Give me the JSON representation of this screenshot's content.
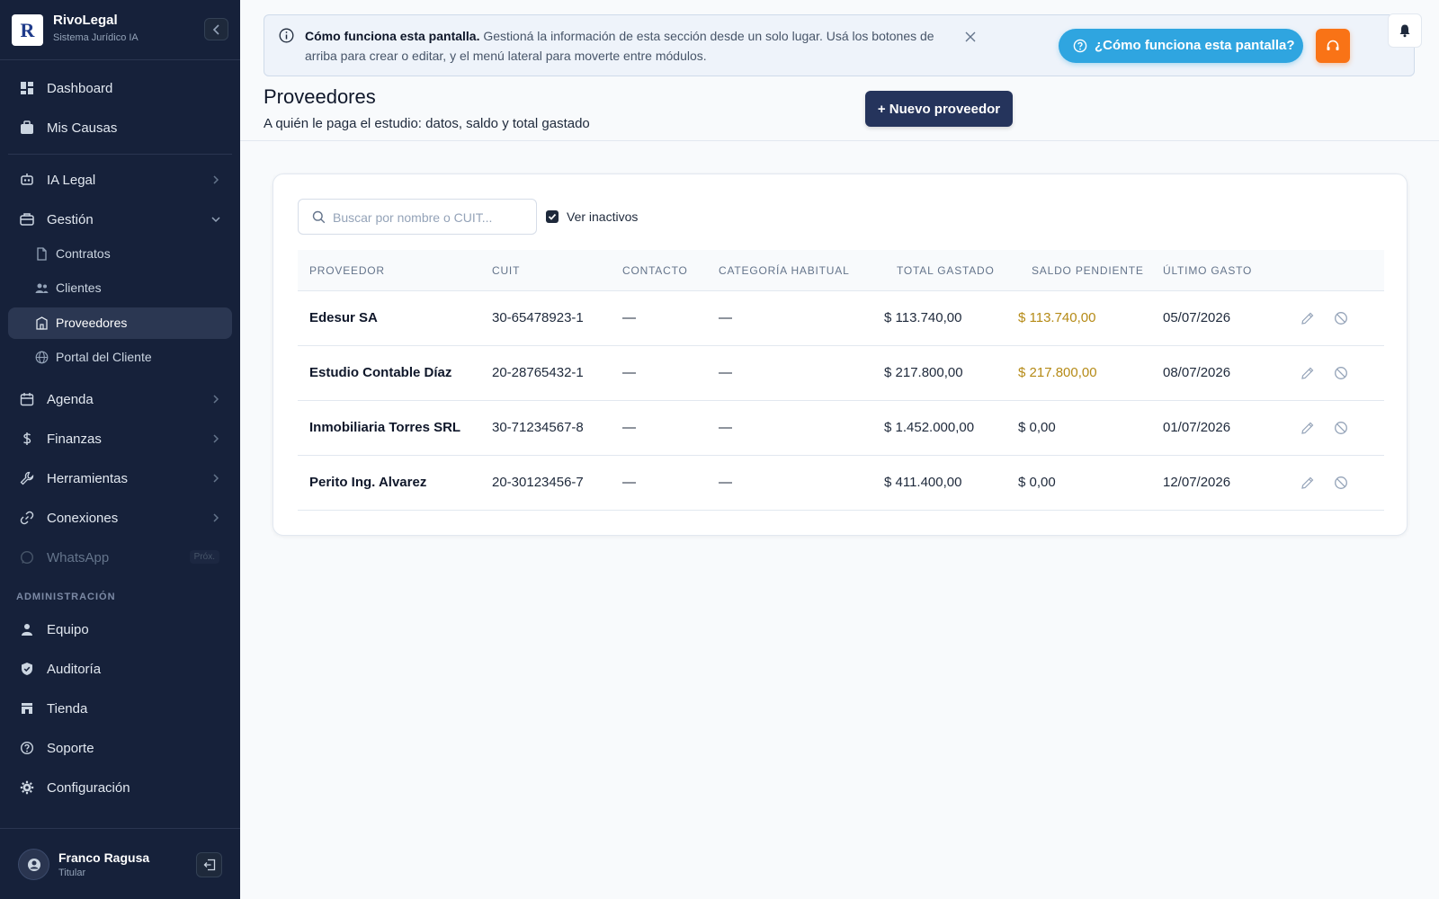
{
  "brand": {
    "name": "RivoLegal",
    "subtitle": "Sistema Jurídico IA",
    "logo_text": "R"
  },
  "sidebar": {
    "items": [
      {
        "label": "Dashboard",
        "icon": "dashboard-icon"
      },
      {
        "label": "Mis Causas",
        "icon": "briefcase-icon"
      },
      {
        "label": "IA Legal",
        "icon": "robot-icon"
      },
      {
        "label": "Gestión",
        "icon": "suitcase-icon"
      },
      {
        "label": "Agenda",
        "icon": "calendar-icon"
      },
      {
        "label": "Finanzas",
        "icon": "dollar-icon"
      },
      {
        "label": "Herramientas",
        "icon": "wrench-icon"
      },
      {
        "label": "Conexiones",
        "icon": "link-icon"
      },
      {
        "label": "WhatsApp",
        "icon": "whatsapp-icon",
        "badge": "Próx."
      }
    ],
    "gestion_sub": [
      {
        "label": "Contratos",
        "icon": "document-icon"
      },
      {
        "label": "Clientes",
        "icon": "users-icon"
      },
      {
        "label": "Proveedores",
        "icon": "building-icon",
        "active": true
      },
      {
        "label": "Portal del Cliente",
        "icon": "globe-icon"
      }
    ],
    "admin_label": "ADMINISTRACIÓN",
    "admin_items": [
      {
        "label": "Equipo",
        "icon": "person-icon"
      },
      {
        "label": "Auditoría",
        "icon": "shield-icon"
      },
      {
        "label": "Tienda",
        "icon": "store-icon"
      },
      {
        "label": "Soporte",
        "icon": "help-circle-icon"
      },
      {
        "label": "Configuración",
        "icon": "gear-icon"
      }
    ]
  },
  "user": {
    "name": "Franco Ragusa",
    "role": "Titular"
  },
  "banner": {
    "title": "Cómo funciona esta pantalla.",
    "text": "Gestioná la información de esta sección desde un solo lugar. Usá los botones de arriba para crear o editar, y el menú lateral para moverte entre módulos."
  },
  "help_button": "¿Cómo funciona esta pantalla?",
  "page": {
    "title": "Proveedores",
    "subtitle": "A quién le paga el estudio: datos, saldo y total gastado",
    "new_button": "+ Nuevo proveedor"
  },
  "filters": {
    "search_placeholder": "Buscar por nombre o CUIT...",
    "search_value": "",
    "show_inactive_label": "Ver inactivos",
    "show_inactive_checked": true
  },
  "table": {
    "headers": [
      "PROVEEDOR",
      "CUIT",
      "CONTACTO",
      "CATEGORÍA HABITUAL",
      "TOTAL GASTADO",
      "SALDO PENDIENTE",
      "ÚLTIMO GASTO"
    ],
    "rows": [
      {
        "name": "Edesur SA",
        "cuit": "30-65478923-1",
        "contact": "—",
        "category": "—",
        "total": "$ 113.740,00",
        "pending": "$ 113.740,00",
        "pending_highlight": true,
        "last": "05/07/2026"
      },
      {
        "name": "Estudio Contable Díaz",
        "cuit": "20-28765432-1",
        "contact": "—",
        "category": "—",
        "total": "$ 217.800,00",
        "pending": "$ 217.800,00",
        "pending_highlight": true,
        "last": "08/07/2026"
      },
      {
        "name": "Inmobiliaria Torres SRL",
        "cuit": "30-71234567-8",
        "contact": "—",
        "category": "—",
        "total": "$ 1.452.000,00",
        "pending": "$ 0,00",
        "pending_highlight": false,
        "last": "01/07/2026"
      },
      {
        "name": "Perito Ing. Alvarez",
        "cuit": "20-30123456-7",
        "contact": "—",
        "category": "—",
        "total": "$ 411.400,00",
        "pending": "$ 0,00",
        "pending_highlight": false,
        "last": "12/07/2026"
      }
    ]
  },
  "colors": {
    "sidebar_bg": "#16213a",
    "primary_button": "#25345c",
    "help_button": "#2fa5e0",
    "support_button": "#f97316",
    "pending_amount": "#b58a16"
  }
}
